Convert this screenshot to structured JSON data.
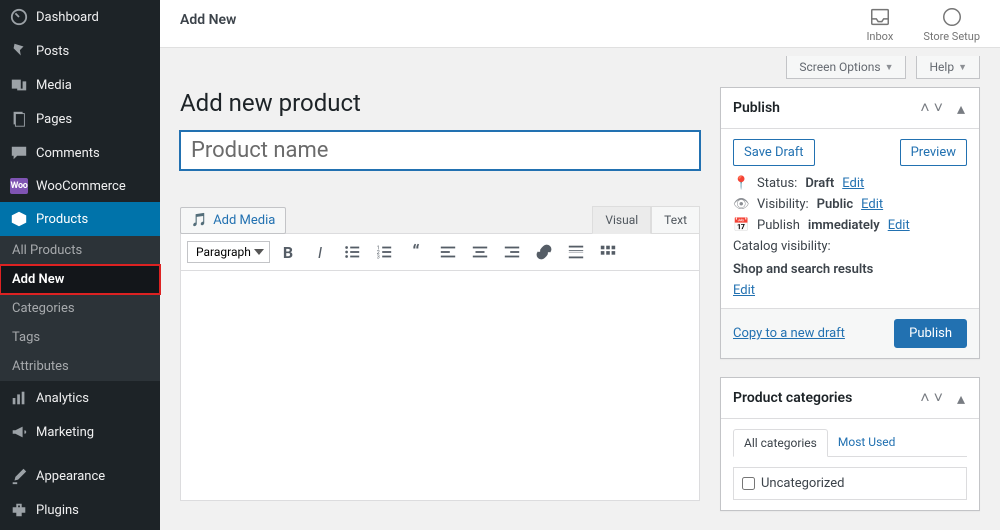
{
  "sidebar": {
    "items": [
      {
        "label": "Dashboard"
      },
      {
        "label": "Posts"
      },
      {
        "label": "Media"
      },
      {
        "label": "Pages"
      },
      {
        "label": "Comments"
      },
      {
        "label": "WooCommerce"
      },
      {
        "label": "Products"
      },
      {
        "label": "Analytics"
      },
      {
        "label": "Marketing"
      },
      {
        "label": "Appearance"
      },
      {
        "label": "Plugins"
      }
    ],
    "submenu": [
      {
        "label": "All Products"
      },
      {
        "label": "Add New"
      },
      {
        "label": "Categories"
      },
      {
        "label": "Tags"
      },
      {
        "label": "Attributes"
      }
    ]
  },
  "topbar": {
    "title": "Add New",
    "inbox": "Inbox",
    "store_setup": "Store Setup"
  },
  "screen_options": "Screen Options",
  "help": "Help",
  "page_title": "Add new product",
  "title_placeholder": "Product name",
  "add_media": "Add Media",
  "editor": {
    "visual": "Visual",
    "text": "Text",
    "paragraph": "Paragraph"
  },
  "publish": {
    "title": "Publish",
    "save_draft": "Save Draft",
    "preview": "Preview",
    "status_label": "Status:",
    "status_value": "Draft",
    "visibility_label": "Visibility:",
    "visibility_value": "Public",
    "schedule_label": "Publish",
    "schedule_value": "immediately",
    "catalog_label": "Catalog visibility:",
    "catalog_value": "Shop and search results",
    "edit": "Edit",
    "copy_draft": "Copy to a new draft",
    "publish_btn": "Publish"
  },
  "categories": {
    "title": "Product categories",
    "tab_all": "All categories",
    "tab_most": "Most Used",
    "items": [
      "Uncategorized"
    ]
  }
}
